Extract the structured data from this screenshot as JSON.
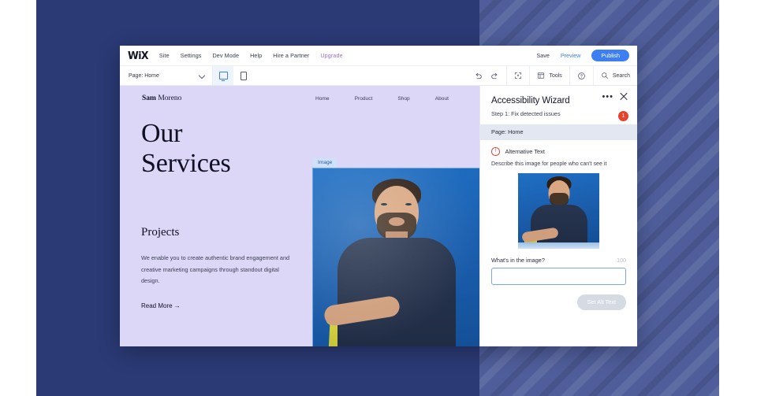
{
  "background": {
    "left_color": "#2b3a75",
    "right_color": "#4f5e9b"
  },
  "editor": {
    "topbar": {
      "logo": "WiX",
      "menu": [
        {
          "label": "Site"
        },
        {
          "label": "Settings"
        },
        {
          "label": "Dev Mode"
        },
        {
          "label": "Help"
        },
        {
          "label": "Hire a Partner"
        },
        {
          "label": "Upgrade",
          "accent": "#9b6ed8"
        }
      ],
      "save_label": "Save",
      "preview_label": "Preview",
      "publish_label": "Publish",
      "publish_color": "#3b7ff2"
    },
    "subbar": {
      "page_selector": "Page: Home",
      "chevron_icon": "chevron-down-icon",
      "desktop_icon": "desktop-view-icon",
      "mobile_icon": "mobile-view-icon",
      "undo_icon": "undo-icon",
      "redo_icon": "redo-icon",
      "zoomout_icon": "zoom-out-icon",
      "tools_label": "Tools",
      "tools_icon": "layout-panels-icon",
      "help_icon": "help-circle-icon",
      "search_label": "Search",
      "search_icon": "search-icon"
    }
  },
  "site": {
    "logo_bold": "Sam",
    "logo_light": "Moreno",
    "nav": [
      {
        "label": "Home"
      },
      {
        "label": "Product"
      },
      {
        "label": "Shop"
      },
      {
        "label": "About"
      }
    ],
    "hero_line1": "Our",
    "hero_line2": "Services",
    "projects_title": "Projects",
    "projects_body": "We enable you to create authentic brand engagement and creative marketing campaigns through standout digital design.",
    "read_more": "Read More →",
    "image_badge": "Image"
  },
  "wizard": {
    "title": "Accessibility Wizard",
    "step": "Step 1: Fix detected issues",
    "badge_count": "1",
    "badge_color": "#e8422e",
    "more_icon": "more-options-icon",
    "close_icon": "close-icon",
    "page_bar": "Page: Home",
    "issue_icon": "warning-circle-icon",
    "issue_title": "Alternative Text",
    "issue_desc": "Describe this image for people who can't see it",
    "thumbnail_name": "image-thumbnail",
    "field_label": "What's in the image?",
    "char_counter": "100",
    "alt_text_value": "",
    "alt_text_placeholder": "",
    "set_button": "Set Alt Text"
  }
}
